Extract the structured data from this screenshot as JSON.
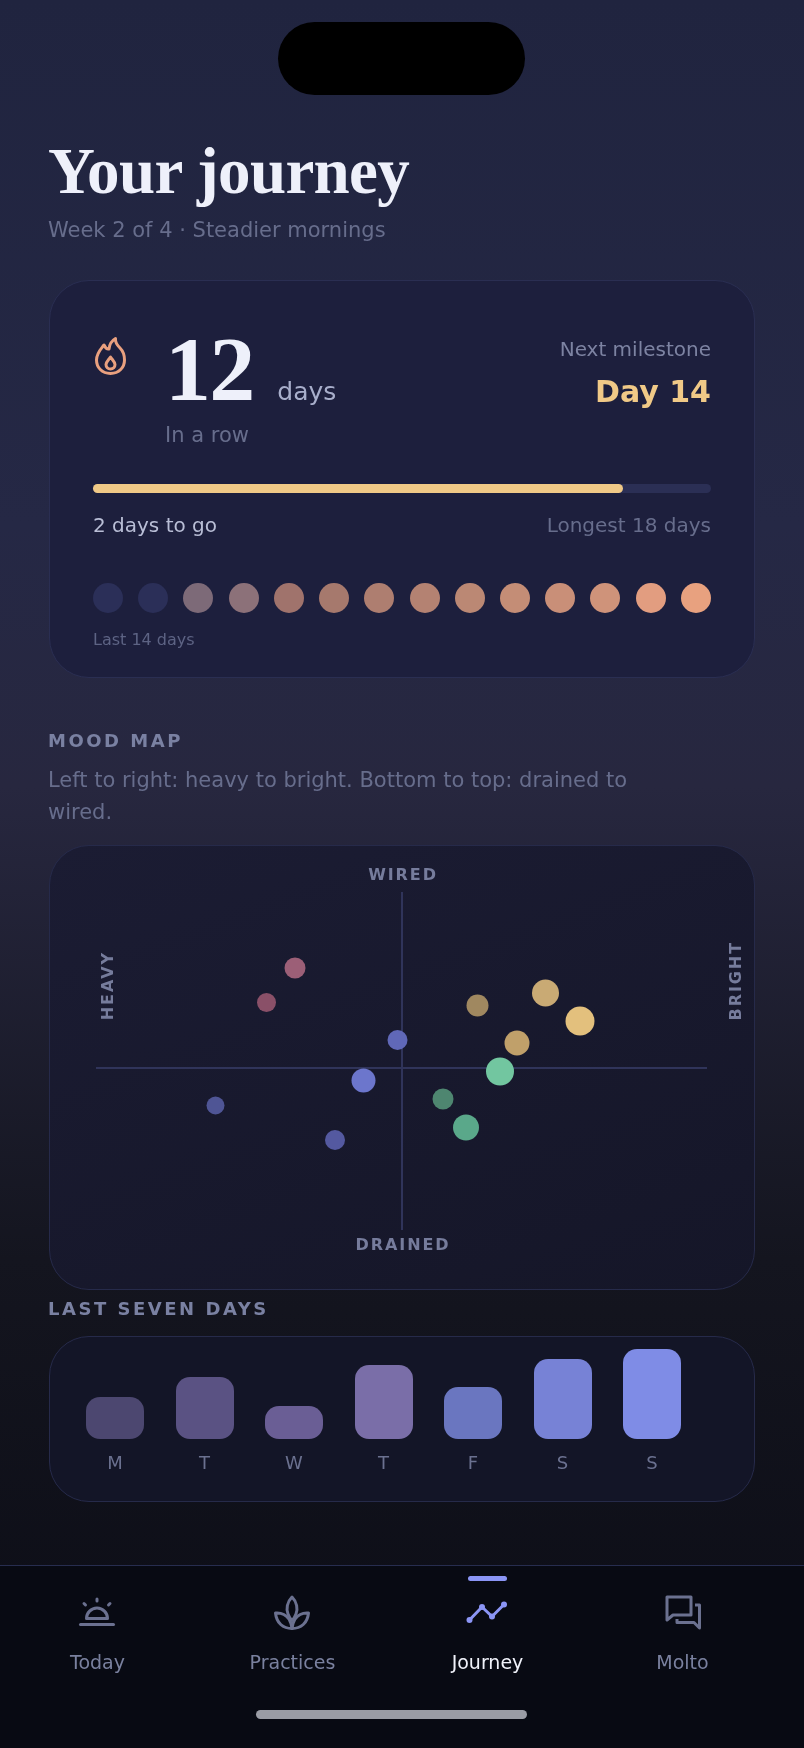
{
  "header": {
    "title": "Your journey",
    "subtitle": "Week 2 of 4 · Steadier mornings"
  },
  "streak": {
    "count": "12",
    "unit": "days",
    "caption": "In a row",
    "milestone_label": "Next milestone",
    "milestone": "Day 14",
    "progress": {
      "level": 0.857
    },
    "remaining": "2 days to go",
    "longest": "Longest 18 days",
    "days": [
      {
        "color": "#2b2f58"
      },
      {
        "color": "#2b2f58"
      },
      {
        "color": "#7d6a78"
      },
      {
        "color": "#8c7179"
      },
      {
        "color": "#a0736c"
      },
      {
        "color": "#a6796d"
      },
      {
        "color": "#ae7e70"
      },
      {
        "color": "#b48272"
      },
      {
        "color": "#bb8874"
      },
      {
        "color": "#c48d76"
      },
      {
        "color": "#c98f78"
      },
      {
        "color": "#cf937a"
      },
      {
        "color": "#e29d80"
      },
      {
        "color": "#e8a17f"
      }
    ],
    "days_caption": "Last 14 days"
  },
  "mood_map": {
    "title": "MOOD MAP",
    "description": "Left to right: heavy to bright. Bottom to top: drained to wired.",
    "axis_labels": {
      "top": "WIRED",
      "bottom": "DRAINED",
      "left": "HEAVY",
      "right": "BRIGHT"
    }
  },
  "last_seven_days": {
    "title": "LAST SEVEN DAYS",
    "days": [
      {
        "label": "M"
      },
      {
        "label": "T"
      },
      {
        "label": "W"
      },
      {
        "label": "T"
      },
      {
        "label": "F"
      },
      {
        "label": "S"
      },
      {
        "label": "S"
      }
    ]
  },
  "nav": {
    "tabs": [
      {
        "label": "Today",
        "selected": false
      },
      {
        "label": "Practices",
        "selected": false
      },
      {
        "label": "Journey",
        "selected": true
      },
      {
        "label": "Molto",
        "selected": false
      }
    ]
  }
}
